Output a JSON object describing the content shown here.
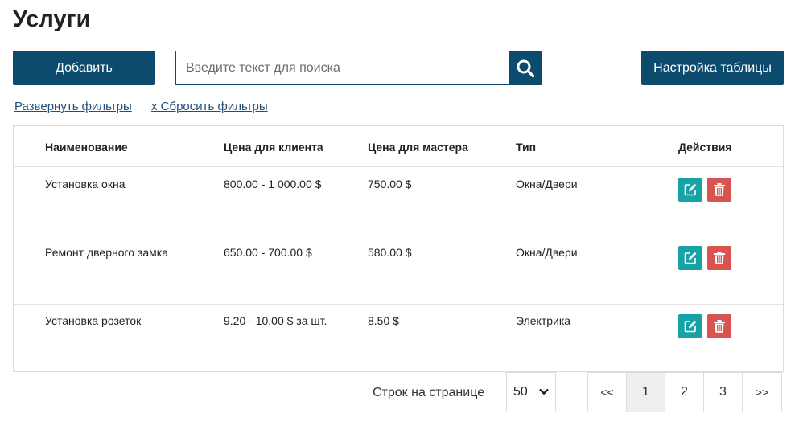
{
  "header": {
    "title": "Услуги"
  },
  "toolbar": {
    "add_label": "Добавить",
    "search_placeholder": "Введите текст для поиска",
    "search_value": "",
    "settings_label": "Настройка таблицы"
  },
  "filters": {
    "expand_label": "Развернуть фильтры",
    "reset_label": "x Сбросить фильтры"
  },
  "table": {
    "columns": [
      "Наименование",
      "Цена для клиента",
      "Цена для мастера",
      "Тип",
      "Действия"
    ],
    "rows": [
      {
        "name": "Установка окна",
        "client_price": "800.00 - 1 000.00 $",
        "master_price": "750.00 $",
        "type": "Окна/Двери"
      },
      {
        "name": "Ремонт дверного замка",
        "client_price": "650.00 - 700.00 $",
        "master_price": "580.00 $",
        "type": "Окна/Двери"
      },
      {
        "name": "Установка розеток",
        "client_price": "9.20 - 10.00 $ за шт.",
        "master_price": "8.50 $",
        "type": "Электрика"
      }
    ]
  },
  "pagination": {
    "rows_per_page_label": "Строк на странице",
    "rows_per_page_value": "50",
    "first": "<<",
    "pages": [
      "1",
      "2",
      "3"
    ],
    "current_page": "1",
    "last": ">>"
  },
  "icons": {
    "search": "search-icon",
    "edit": "edit-icon",
    "delete": "trash-icon",
    "select": "chevron-down-icon"
  },
  "colors": {
    "primary": "#0c4a6e",
    "edit": "#17a2a6",
    "delete": "#d9534f",
    "link": "#1e4e79"
  }
}
